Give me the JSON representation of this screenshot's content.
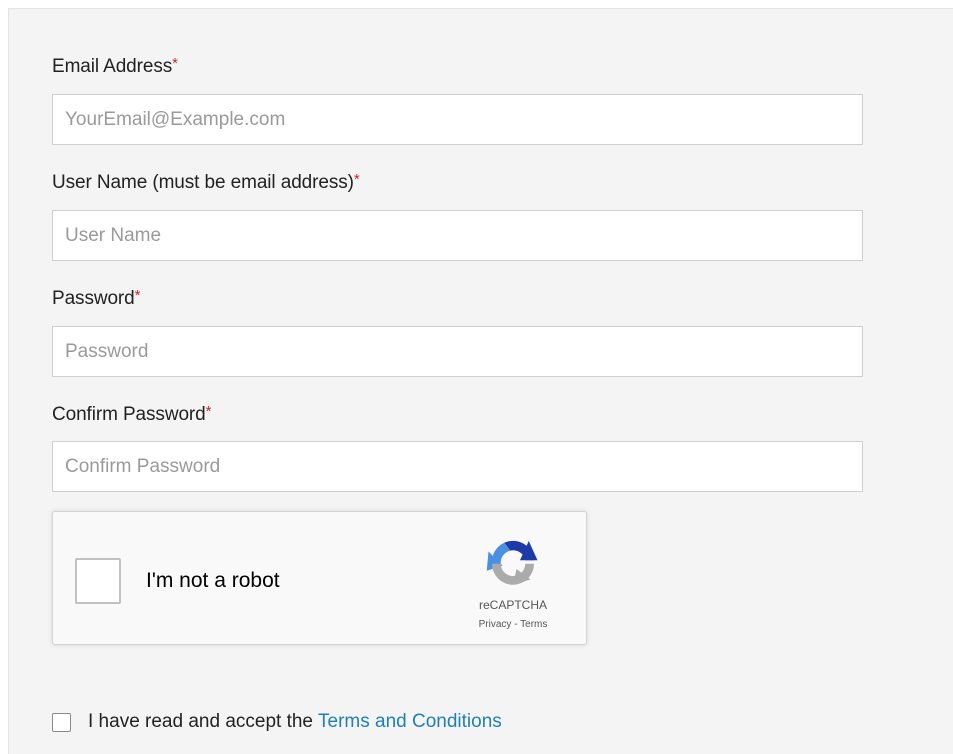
{
  "form": {
    "required_marker": "*",
    "fields": [
      {
        "label": "Email Address",
        "placeholder": "YourEmail@Example.com",
        "value": ""
      },
      {
        "label": "User Name (must be email address)",
        "placeholder": "User Name",
        "value": ""
      },
      {
        "label": "Password",
        "placeholder": "Password",
        "value": ""
      },
      {
        "label": "Confirm Password",
        "placeholder": "Confirm Password",
        "value": ""
      }
    ]
  },
  "captcha": {
    "label": "I'm not a robot",
    "brand": "reCAPTCHA",
    "privacy": "Privacy",
    "separator": " - ",
    "terms": "Terms",
    "logo_icon": "recaptcha-logo-icon"
  },
  "terms": {
    "text": "I have read and accept the",
    "link": "Terms and Conditions",
    "checked": false
  },
  "colors": {
    "link": "#1f7fb8",
    "required": "#c62828",
    "panel_bg": "#f4f4f4"
  }
}
